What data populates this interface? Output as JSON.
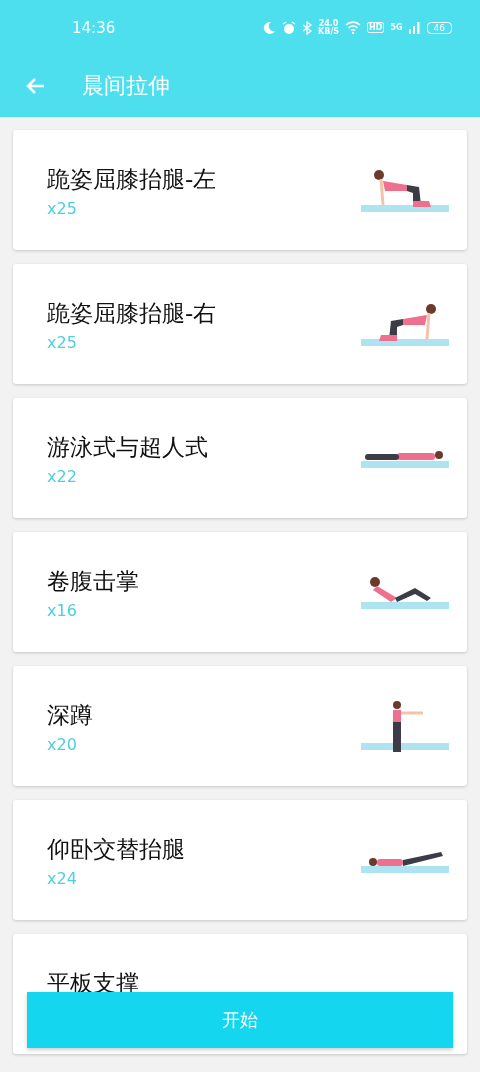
{
  "status_bar": {
    "time": "14:36",
    "speed": "24.0",
    "speed_unit": "KB/S",
    "hd": "HD",
    "network": "5G",
    "battery": "46"
  },
  "toolbar": {
    "title": "晨间拉伸"
  },
  "exercises": [
    {
      "name": "跪姿屈膝抬腿-左",
      "reps": "x25",
      "kind": "kneel-left"
    },
    {
      "name": "跪姿屈膝抬腿-右",
      "reps": "x25",
      "kind": "kneel-right"
    },
    {
      "name": "游泳式与超人式",
      "reps": "x22",
      "kind": "prone"
    },
    {
      "name": "卷腹击掌",
      "reps": "x16",
      "kind": "crunch"
    },
    {
      "name": "深蹲",
      "reps": "x20",
      "kind": "stand"
    },
    {
      "name": "仰卧交替抬腿",
      "reps": "x24",
      "kind": "supine"
    },
    {
      "name": "平板支撑"
    }
  ],
  "start_button": {
    "label": "开始"
  }
}
